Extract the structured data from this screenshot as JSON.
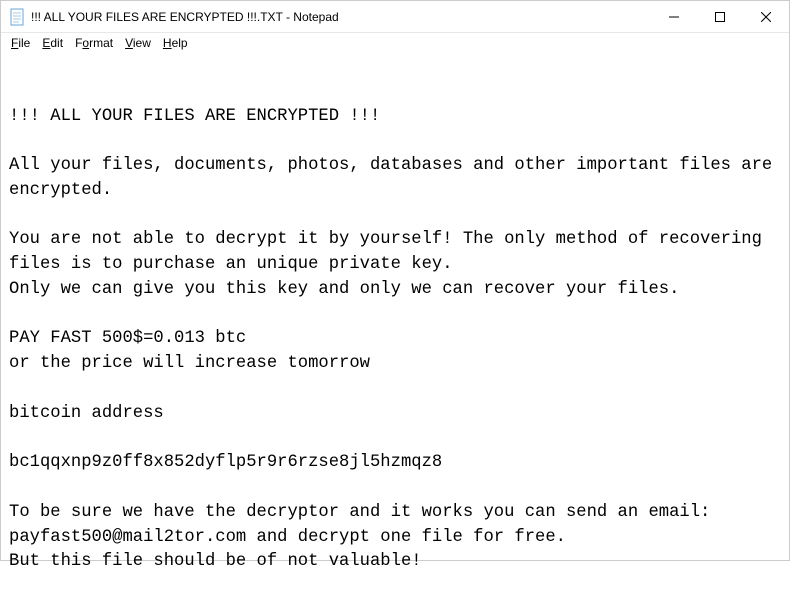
{
  "window": {
    "title": "!!! ALL YOUR FILES ARE ENCRYPTED !!!.TXT - Notepad"
  },
  "menubar": {
    "file": "File",
    "edit": "Edit",
    "format": "Format",
    "view": "View",
    "help": "Help"
  },
  "document": {
    "text": "!!! ALL YOUR FILES ARE ENCRYPTED !!!\n\nAll your files, documents, photos, databases and other important files are encrypted.\n\nYou are not able to decrypt it by yourself! The only method of recovering files is to purchase an unique private key.\nOnly we can give you this key and only we can recover your files.\n\nPAY FAST 500$=0.013 btc\nor the price will increase tomorrow\n\nbitcoin address\n\nbc1qqxnp9z0ff8x852dyflp5r9r6rzse8jl5hzmqz8\n\nTo be sure we have the decryptor and it works you can send an email: payfast500@mail2tor.com and decrypt one file for free.\nBut this file should be of not valuable!"
  }
}
